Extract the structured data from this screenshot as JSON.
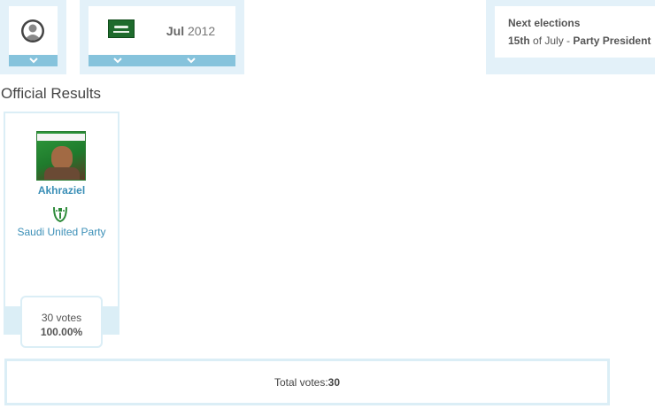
{
  "filters": {
    "date": {
      "month": "Jul",
      "year": "2012"
    }
  },
  "next_elections": {
    "title": "Next elections",
    "day": "15th",
    "of_month": " of July - ",
    "position": "Party President"
  },
  "heading": "Official Results",
  "candidates": [
    {
      "name": "Akhraziel",
      "party": "Saudi United Party",
      "votes_label": "30 votes",
      "percent": "100.00%"
    }
  ],
  "total": {
    "label": "Total votes: ",
    "value": "30"
  },
  "colors": {
    "panel_bg": "#e3f1f9",
    "chevron_bar": "#86c3dc",
    "link_blue": "#3b8fb7",
    "border_light": "#dbeef6"
  },
  "icons": {
    "avatar": "user-avatar-icon",
    "flag": "saudi-arabia-flag-icon",
    "chevron": "chevron-down-icon",
    "party_logo": "party-emblem-icon"
  }
}
